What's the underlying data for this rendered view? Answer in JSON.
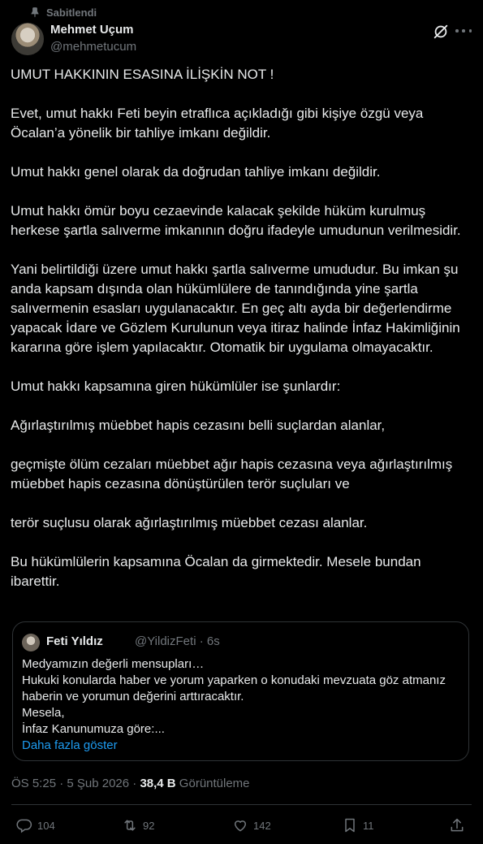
{
  "pinned": {
    "label": "Sabitlendi"
  },
  "author": {
    "name": "Mehmet Uçum",
    "handle": "@mehmetucum"
  },
  "tweet": {
    "paragraphs": [
      "UMUT HAKKININ ESASINA İLİŞKİN NOT !",
      "Evet, umut hakkı Feti beyin etraflıca açıkladığı gibi kişiye özgü veya Öcalan’a yönelik bir tahliye imkanı değildir.",
      "Umut hakkı genel olarak da doğrudan tahliye imkanı değildir.",
      "Umut hakkı ömür boyu cezaevinde kalacak şekilde hüküm kurulmuş herkese şartla salıverme imkanının doğru ifadeyle umudunun verilmesidir.",
      "Yani belirtildiği üzere umut hakkı şartla salıverme umududur. Bu imkan şu anda kapsam dışında olan hükümlülere de tanındığında yine şartla salıvermenin esasları uygulanacaktır. En geç altı ayda bir değerlendirme yapacak İdare ve Gözlem Kurulunun veya itiraz halinde İnfaz Hakimliğinin kararına göre işlem yapılacaktır. Otomatik bir uygulama olmayacaktır.",
      "Umut hakkı kapsamına giren hükümlüler ise şunlardır:",
      "Ağırlaştırılmış müebbet hapis cezasını belli suçlardan alanlar,",
      "geçmişte ölüm cezaları müebbet ağır hapis cezasına veya ağırlaştırılmış müebbet hapis cezasına dönüştürülen terör suçluları ve",
      "terör suçlusu olarak ağırlaştırılmış müebbet cezası alanlar.",
      "Bu hükümlülerin kapsamına Öcalan da girmektedir. Mesele bundan ibarettir."
    ]
  },
  "quote": {
    "name": "Feti Yıldız",
    "handle_time": "@YildizFeti · 6s",
    "lines": [
      "Medyamızın  değerli mensupları…",
      "Hukuki konularda haber ve yorum yaparken o konudaki mevzuata göz atmanız haberin ve yorumun değerini arttıracaktır.",
      "Mesela,",
      "İnfaz Kanunumuza göre:..."
    ],
    "show_more": "Daha fazla göster"
  },
  "meta": {
    "time": "ÖS 5:25 · 5 Şub 2026 · ",
    "views": "38,4 B",
    "views_label": " Görüntüleme"
  },
  "actions": {
    "replies": "104",
    "reposts": "92",
    "likes": "142",
    "bookmarks": "11"
  },
  "colors": {
    "background": "#000000",
    "text": "#e7e9ea",
    "muted": "#71767b",
    "link": "#1d9bf0",
    "border": "#2f3336"
  }
}
